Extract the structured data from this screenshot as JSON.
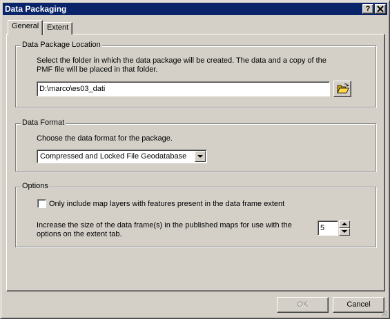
{
  "window": {
    "title": "Data Packaging",
    "help_label": "?",
    "close_label": "✕"
  },
  "tabs": [
    {
      "label": "General",
      "selected": true
    },
    {
      "label": "Extent",
      "selected": false
    }
  ],
  "location": {
    "legend": "Data Package Location",
    "description_line1": "Select the folder in which the data package will be created. The data and a copy of the",
    "description_line2": "PMF file will be placed in that folder.",
    "path_value": "D:\\marco\\es03_dati",
    "browse_icon": "folder-open-icon"
  },
  "format": {
    "legend": "Data Format",
    "description": "Choose the data format for the package.",
    "selected_value": "Compressed and Locked File Geodatabase"
  },
  "options": {
    "legend": "Options",
    "checkbox_label": "Only include map layers with features present in the data frame extent",
    "checkbox_checked": false,
    "extent_text_line1": "Increase the size of the data frame(s) in the published maps for use with the",
    "extent_text_line2": "options on the extent tab.",
    "extent_value": "5"
  },
  "buttons": {
    "ok_label": "OK",
    "ok_enabled": false,
    "cancel_label": "Cancel"
  },
  "colors": {
    "titlebar": "#0a246a",
    "face": "#d4d0c8"
  }
}
